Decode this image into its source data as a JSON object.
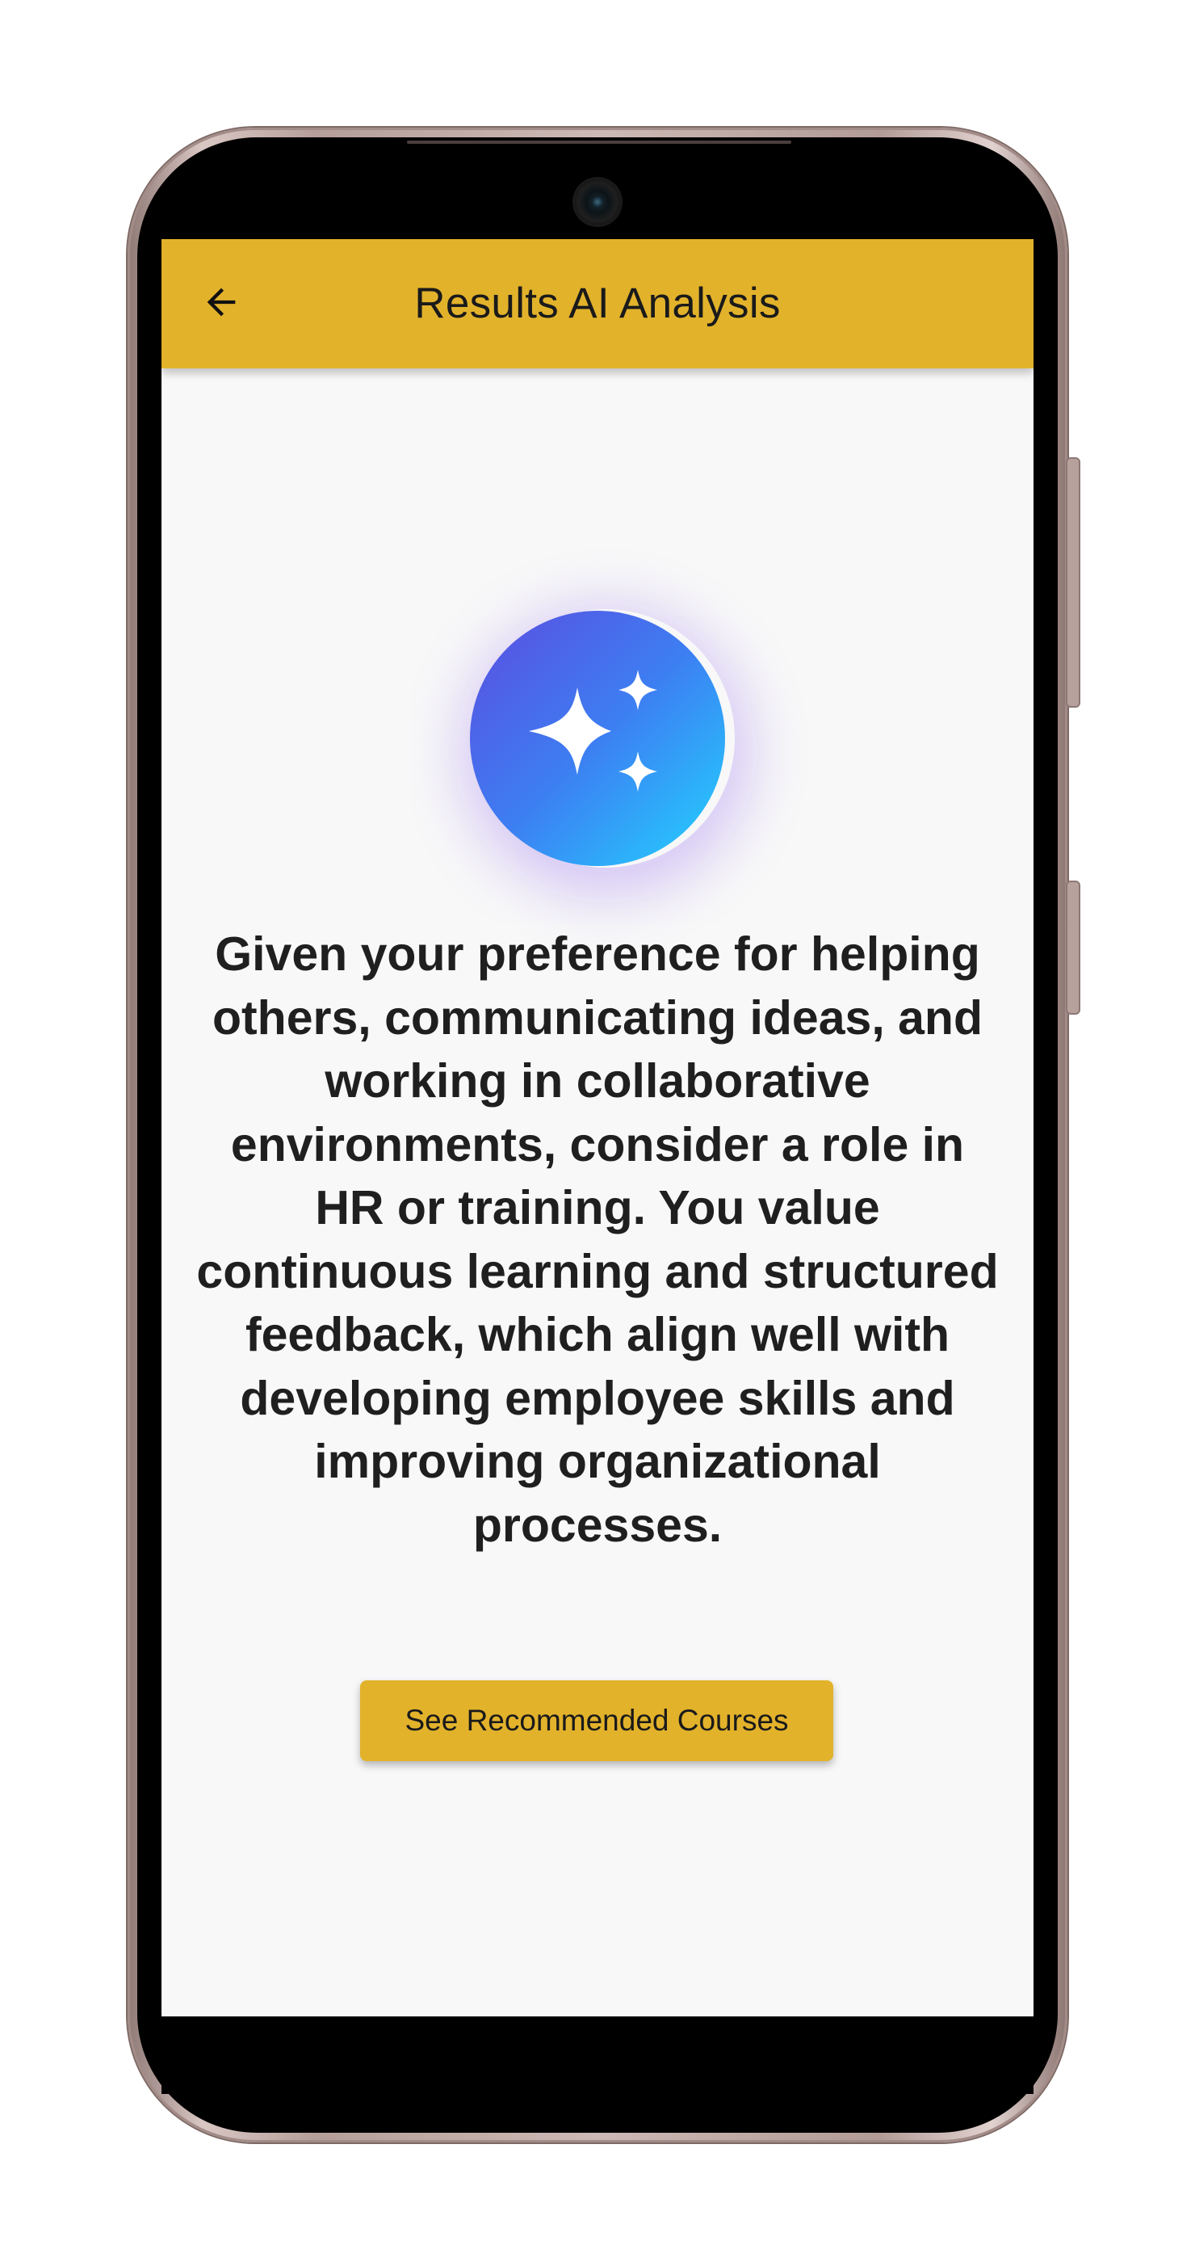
{
  "app_bar": {
    "title": "Results AI Analysis",
    "back_icon": "arrow-left-icon",
    "background_color": "#e2b22b"
  },
  "ai_badge": {
    "icon": "sparkles-icon",
    "gradient_colors": [
      "#5b4de0",
      "#3d7ef2",
      "#22d4ff"
    ]
  },
  "analysis": {
    "text": "Given your preference for helping others, communicating ideas, and working in collaborative environments, consider a role in HR or training. You value continuous learning and structured feedback, which align well with developing employee skills and improving organizational processes."
  },
  "actions": {
    "recommended_courses_label": "See Recommended Courses",
    "accent_color": "#e2b22b"
  }
}
